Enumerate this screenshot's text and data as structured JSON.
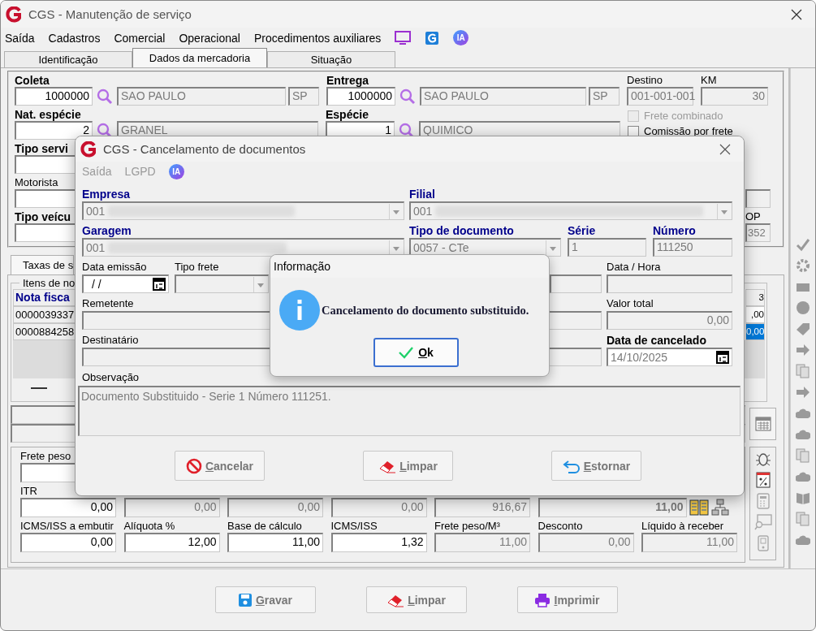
{
  "window": {
    "title": "CGS - Manutenção de serviço"
  },
  "menu": {
    "items": [
      {
        "label": "Saída",
        "disabled": false
      },
      {
        "label": "Cadastros",
        "disabled": false
      },
      {
        "label": "Comercial",
        "disabled": false
      },
      {
        "label": "Operacional",
        "disabled": false
      },
      {
        "label": "Procedimentos auxiliares",
        "disabled": false
      }
    ],
    "badge": "IA"
  },
  "tabs": [
    {
      "label": "Identificação",
      "selected": false
    },
    {
      "label": "Dados da mercadoria",
      "selected": true
    },
    {
      "label": "Situação",
      "selected": false
    }
  ],
  "cargo": {
    "coleta": {
      "label": "Coleta",
      "code": "1000000",
      "city": "SAO PAULO",
      "uf": "SP"
    },
    "entrega": {
      "label": "Entrega",
      "code": "1000000",
      "city": "SAO PAULO",
      "uf": "SP"
    },
    "destino": {
      "label": "Destino",
      "value": "001-001-001"
    },
    "km": {
      "label": "KM",
      "value": "30"
    },
    "nat_especie": {
      "label": "Nat. espécie",
      "code": "2",
      "name": "GRANEL"
    },
    "especie": {
      "label": "Espécie",
      "code": "1",
      "name": "QUIMICO"
    },
    "checkboxes": [
      {
        "label": "Frete combinado",
        "checked": false,
        "disabled": true
      },
      {
        "label": "Comissão por frete",
        "checked": false,
        "disabled": false
      }
    ],
    "left_fields": [
      {
        "label": "Tipo servi",
        "bold": true
      },
      {
        "label": "Motorista",
        "bold": false
      },
      {
        "label": "Tipo veícu",
        "bold": true
      }
    ],
    "op": {
      "label": "OP",
      "value": "352"
    }
  },
  "lower_tab": {
    "label": "Taxas de s",
    "selected": true
  },
  "items": {
    "title": "Itens de no",
    "columns": [
      "Nota fisca",
      "3"
    ],
    "rows": [
      {
        "cells": [
          "0000039337",
          ",00"
        ],
        "selected": false
      },
      {
        "cells": [
          "0000884258",
          "0,00"
        ],
        "selected": true
      }
    ]
  },
  "totals": {
    "frete_peso": {
      "label": "Frete peso"
    },
    "upper_fields": [
      {
        "label": "ITR",
        "value": "0,00",
        "editable": true,
        "bold": false
      },
      {
        "value": "0,00",
        "editable": false,
        "bold": false
      },
      {
        "value": "0,00",
        "editable": false,
        "bold": false
      },
      {
        "value": "0,00",
        "editable": false,
        "bold": false
      },
      {
        "value": "916,67",
        "editable": false,
        "bold": false
      },
      {
        "value": "11,00",
        "editable": false,
        "bold": true
      }
    ],
    "lower_fields": [
      {
        "label": "ICMS/ISS a embutir",
        "value": "0,00",
        "editable": true,
        "bold": false
      },
      {
        "label": "Alíquota %",
        "value": "12,00",
        "editable": true,
        "bold": false
      },
      {
        "label": "Base de cálculo",
        "value": "11,00",
        "editable": true,
        "bold": false
      },
      {
        "label": "ICMS/ISS",
        "value": "1,32",
        "editable": true,
        "bold": false
      },
      {
        "label": "Frete peso/M³",
        "value": "11,00",
        "editable": false,
        "bold": false
      },
      {
        "label": "Desconto",
        "value": "0,00",
        "editable": false,
        "bold": false
      },
      {
        "label": "Líquido à receber",
        "value": "11,00",
        "editable": false,
        "bold": false
      }
    ]
  },
  "footer_buttons": [
    {
      "label": "Gravar",
      "kind": "save"
    },
    {
      "label": "Limpar",
      "kind": "clear"
    },
    {
      "label": "Imprimir",
      "kind": "print"
    }
  ],
  "cancel_dialog": {
    "title": "CGS - Cancelamento de documentos",
    "menu": {
      "items": [
        {
          "label": "Saída",
          "disabled": true
        },
        {
          "label": "LGPD",
          "disabled": true
        }
      ],
      "badge": "IA"
    },
    "empresa": {
      "label": "Empresa",
      "value": "001"
    },
    "filial": {
      "label": "Filial",
      "value": "001"
    },
    "garagem": {
      "label": "Garagem",
      "value": "001"
    },
    "tipo_documento": {
      "label": "Tipo de documento",
      "value": "0057 - CTe"
    },
    "serie": {
      "label": "Série",
      "value": "1"
    },
    "numero": {
      "label": "Número",
      "value": "111250"
    },
    "data_emissao": {
      "label": "Data emissão",
      "value": "/ /"
    },
    "tipo_frete": {
      "label": "Tipo frete"
    },
    "data_hora": {
      "label": "Data / Hora"
    },
    "remetente": {
      "label": "Remetente"
    },
    "valor_total": {
      "label": "Valor total",
      "value": "0,00"
    },
    "destinatario": {
      "label": "Destinatário"
    },
    "data_cancelado": {
      "label": "Data de cancelado",
      "value": "14/10/2025"
    },
    "observacao": {
      "label": "Observação",
      "value": "Documento Substituido - Serie 1 Número 111251."
    },
    "buttons": [
      {
        "label": "Cancelar",
        "kind": "cancel"
      },
      {
        "label": "Limpar",
        "kind": "clear"
      },
      {
        "label": "Estornar",
        "kind": "undo"
      }
    ]
  },
  "message_box": {
    "title": "Informação",
    "message": "Cancelamento do documento substituido.",
    "button": "Ok"
  }
}
